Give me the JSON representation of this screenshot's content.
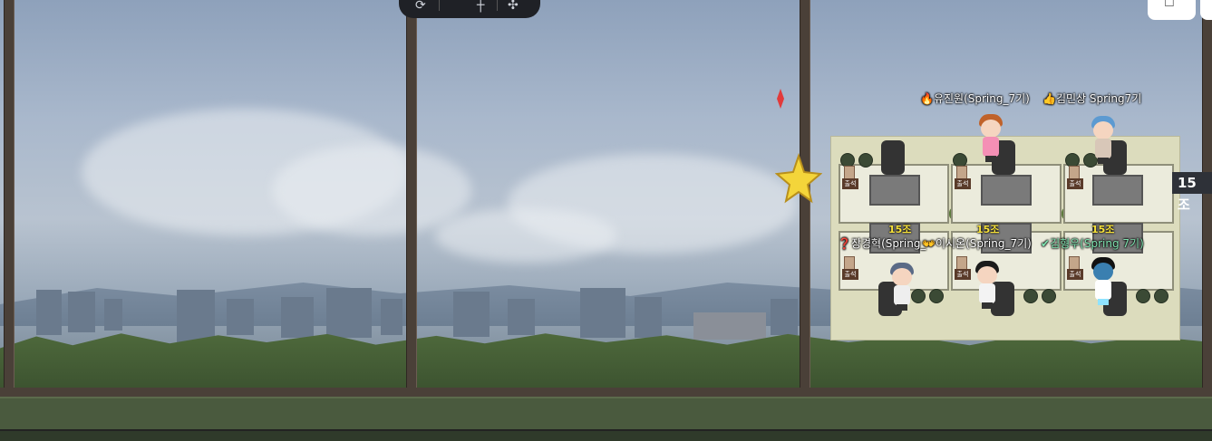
{
  "toolbar": {
    "icons": [
      "refresh-icon",
      "crosshair-icon",
      "move-icon"
    ],
    "labels": [
      "⟳",
      "┼",
      "✣"
    ]
  },
  "corner_button": {
    "icon": "square-icon",
    "label": "☐"
  },
  "room_label": "15조",
  "top_names": {
    "left": {
      "emoji": "🔥",
      "text": "유진원(Spring_7기)"
    },
    "right": {
      "emoji": "👍",
      "text": "김민상 Spring7기"
    }
  },
  "desk_labels": [
    "출석",
    "출석",
    "출석",
    "출석",
    "출석",
    "출석"
  ],
  "teams": [
    "15조",
    "15조",
    "15조"
  ],
  "seat_names": [
    {
      "emoji": "❓",
      "text": "장경혁(Spring_",
      "green": false
    },
    {
      "emoji": "👐",
      "text": "이시온(Spring_7기)",
      "green": false
    },
    {
      "emoji": "✔",
      "text": "김형우(Spring 7기)",
      "green": true
    }
  ],
  "colors": {
    "sky_top": "#8ea1bb",
    "frame": "#4a4038",
    "floor": "#4a5a3e",
    "office_bg": "#dcdcbd",
    "team_label": "#f7e23a"
  }
}
